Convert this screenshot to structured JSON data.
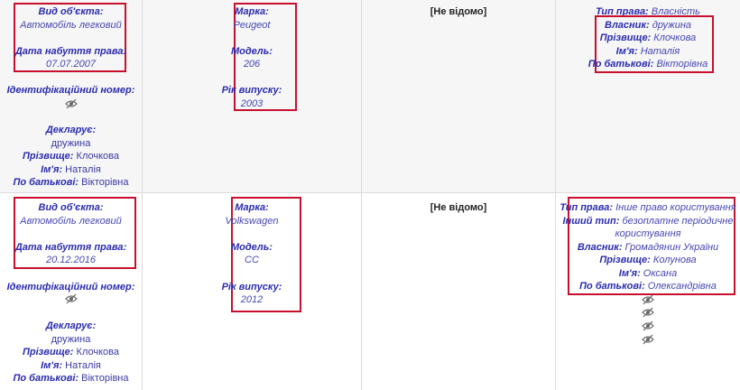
{
  "labels": {
    "object_type": "Вид об'єкта:",
    "acquired_date": "Дата набуття права:",
    "id_number": "Ідентифікаційний номер:",
    "declarant": "Декларує:",
    "surname": "Прізвище:",
    "name": "Ім'я:",
    "patronymic": "По батькові:",
    "brand": "Марка:",
    "model": "Модель:",
    "year": "Рік випуску:",
    "right_type": "Тип права:",
    "other_type": "Інший тип:",
    "owner": "Власник:"
  },
  "icons": {
    "hidden": "hidden-eye-icon"
  },
  "rows": [
    {
      "object_type": "Автомобіль легковий",
      "acquired_date": "07.07.2007",
      "declarant": "дружина",
      "surname": "Клочкова",
      "name": "Наталія",
      "patronymic": "Вікторівна",
      "brand": "Peugeot",
      "model": "206",
      "year": "2003",
      "unknown": "[Не відомо]",
      "right_type": "Власність",
      "owner": "дружина",
      "owner_surname": "Клочкова",
      "owner_name": "Наталія",
      "owner_patronymic": "Вікторівна"
    },
    {
      "object_type": "Автомобіль легковий",
      "acquired_date": "20.12.2016",
      "declarant": "дружина",
      "surname": "Клочкова",
      "name": "Наталія",
      "patronymic": "Вікторівна",
      "brand": "Volkswagen",
      "model": "CC",
      "year": "2012",
      "unknown": "[Не відомо]",
      "right_type": "Інше право користування",
      "other_type_1": "безоплатне періодичне",
      "other_type_2": "користування",
      "owner": "Громадянин України",
      "owner_surname": "Колунова",
      "owner_name": "Оксана",
      "owner_patronymic": "Олександрівна"
    }
  ],
  "highlight_color": "#c8102e"
}
